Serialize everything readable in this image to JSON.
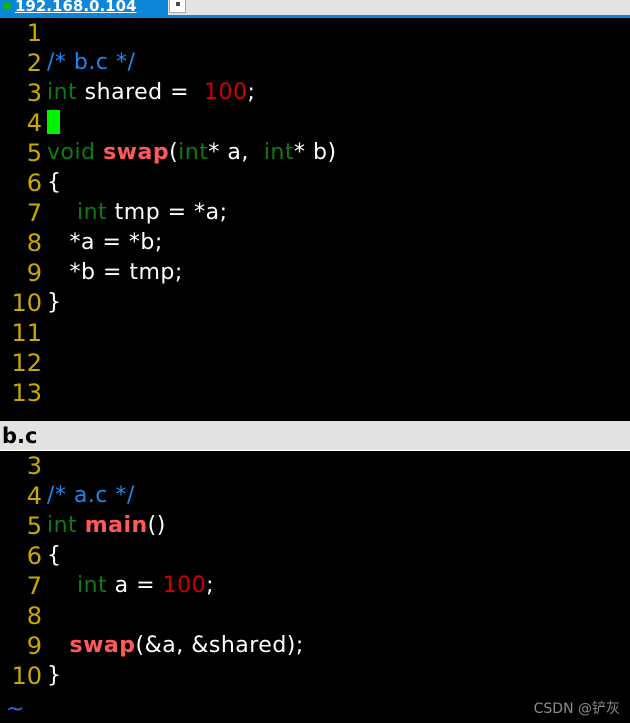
{
  "window": {
    "title": "192.168.0.104",
    "status_dot": "green-connection-dot",
    "tab_glyph": "small-square-icon"
  },
  "editor": {
    "top_pane": {
      "filename": "b.c",
      "first_visible_line": 1,
      "cursor": {
        "line": 4,
        "column": 1
      },
      "lines": [
        {
          "num": "1",
          "tokens": []
        },
        {
          "num": "2",
          "tokens": [
            {
              "t": "/* b.c */",
              "c": "comment"
            }
          ]
        },
        {
          "num": "3",
          "tokens": [
            {
              "t": "int",
              "c": "type"
            },
            {
              "t": " shared = ",
              "c": "plain"
            },
            {
              "t": " 100",
              "c": "num-br"
            },
            {
              "t": ";",
              "c": "plain"
            }
          ]
        },
        {
          "num": "4",
          "tokens": [
            {
              "t": "",
              "c": "cursor"
            }
          ]
        },
        {
          "num": "5",
          "tokens": [
            {
              "t": "void ",
              "c": "type"
            },
            {
              "t": "swap",
              "c": "func"
            },
            {
              "t": "(",
              "c": "plain"
            },
            {
              "t": "int",
              "c": "type"
            },
            {
              "t": "* a, ",
              "c": "plain"
            },
            {
              "t": " int",
              "c": "type"
            },
            {
              "t": "* b)",
              "c": "plain"
            }
          ]
        },
        {
          "num": "6",
          "tokens": [
            {
              "t": "{",
              "c": "plain"
            }
          ]
        },
        {
          "num": "7",
          "tokens": [
            {
              "t": "    ",
              "c": "plain"
            },
            {
              "t": "int",
              "c": "type"
            },
            {
              "t": " tmp = *a;",
              "c": "plain"
            }
          ]
        },
        {
          "num": "8",
          "tokens": [
            {
              "t": "   *a = *b;",
              "c": "plain"
            }
          ]
        },
        {
          "num": "9",
          "tokens": [
            {
              "t": "   *b = tmp;",
              "c": "plain"
            }
          ]
        },
        {
          "num": "10",
          "tokens": [
            {
              "t": "}",
              "c": "plain"
            }
          ]
        },
        {
          "num": "11",
          "tokens": []
        },
        {
          "num": "12",
          "tokens": []
        },
        {
          "num": "13",
          "tokens": []
        }
      ]
    },
    "status_bar": {
      "filename": "b.c"
    },
    "bottom_pane": {
      "filename": "a.c",
      "first_visible_line": 3,
      "lines": [
        {
          "num": "3",
          "tokens": []
        },
        {
          "num": "4",
          "tokens": [
            {
              "t": "/* a.c */",
              "c": "comment"
            }
          ]
        },
        {
          "num": "5",
          "tokens": [
            {
              "t": "int ",
              "c": "type"
            },
            {
              "t": "main",
              "c": "func"
            },
            {
              "t": "()",
              "c": "plain"
            }
          ]
        },
        {
          "num": "6",
          "tokens": [
            {
              "t": "{",
              "c": "plain"
            }
          ]
        },
        {
          "num": "7",
          "tokens": [
            {
              "t": "    ",
              "c": "plain"
            },
            {
              "t": "int",
              "c": "type"
            },
            {
              "t": " a = ",
              "c": "plain"
            },
            {
              "t": "100",
              "c": "num"
            },
            {
              "t": ";",
              "c": "plain"
            }
          ]
        },
        {
          "num": "8",
          "tokens": []
        },
        {
          "num": "9",
          "tokens": [
            {
              "t": "   ",
              "c": "plain"
            },
            {
              "t": "swap",
              "c": "func"
            },
            {
              "t": "(&a, &shared);",
              "c": "plain"
            }
          ]
        },
        {
          "num": "10",
          "tokens": [
            {
              "t": "}",
              "c": "plain"
            }
          ]
        }
      ]
    },
    "empty_marker": "~"
  },
  "watermark": {
    "text": "CSDN @铲灰"
  },
  "colors": {
    "background": "#000000",
    "titlebar": "#0d86d8",
    "line_number": "#c9a800",
    "comment": "#1e86f0",
    "type_keyword": "#0f7a14",
    "function_name": "#ff5a5a",
    "number_literal": "#cc0000",
    "plain_text": "#ffffff",
    "cursor": "#00f200",
    "status_bar_bg": "#e2e2e2",
    "status_bar_fg": "#000000",
    "tilde": "#2f6fd0",
    "watermark": "#8c8c8c"
  }
}
